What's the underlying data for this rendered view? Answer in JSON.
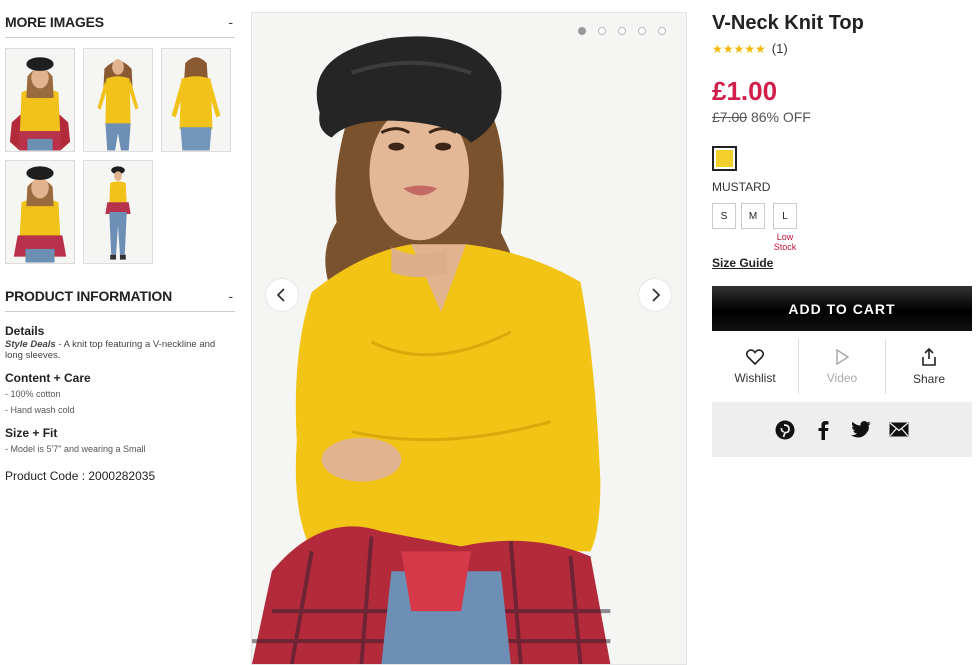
{
  "sidebar": {
    "more_images_title": "MORE IMAGES",
    "more_images_toggle": "-",
    "product_info_title": "PRODUCT INFORMATION",
    "product_info_toggle": "-",
    "details_heading": "Details",
    "details_brand": "Style Deals",
    "details_text": " - A knit top featuring a V-neckline and long sleeves.",
    "content_heading": "Content + Care",
    "content_lines": [
      "- 100% cotton",
      "- Hand wash cold"
    ],
    "size_heading": "Size + Fit",
    "size_lines": [
      "- Model is 5'7\" and wearing a Small"
    ],
    "product_code": "Product Code : 2000282035"
  },
  "product": {
    "title": "V-Neck Knit Top",
    "stars": "★★★★★",
    "rating_count": "(1)",
    "price": "£1.00",
    "was_price": "£7.00",
    "discount": "86% OFF",
    "color_name": "MUSTARD",
    "swatch_color": "#f3cf2b",
    "sizes": [
      "S",
      "M",
      "L"
    ],
    "low_stock_label": "Low Stock",
    "size_guide": "Size Guide",
    "add_to_cart": "ADD TO CART",
    "actions": {
      "wishlist": "Wishlist",
      "video": "Video",
      "share": "Share"
    }
  },
  "gallery": {
    "dot_count": 5,
    "active_dot": 1,
    "prev_icon": "chevron-left-icon",
    "next_icon": "chevron-right-icon"
  },
  "colors": {
    "price_red": "#d11e4b",
    "top_yellow": "#f2c416",
    "star": "#f5b800"
  }
}
